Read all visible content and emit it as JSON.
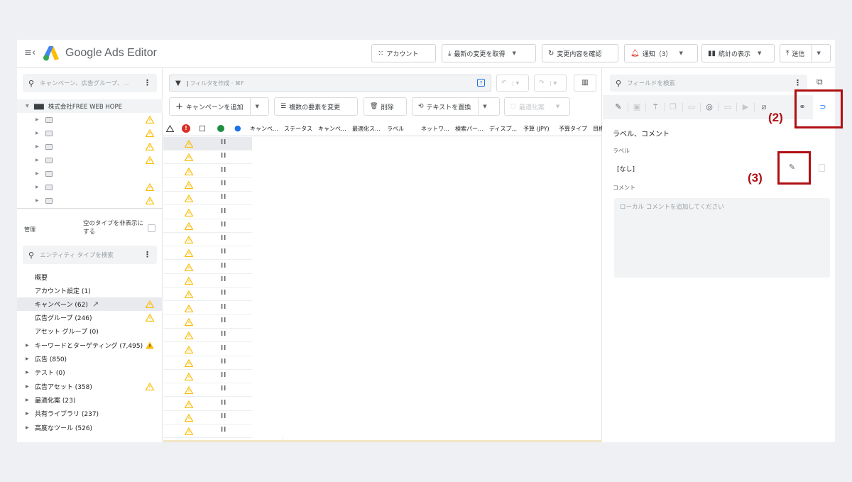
{
  "header": {
    "title": "Google Ads Editor",
    "buttons": {
      "account": "アカウント",
      "get_recent": "最新の変更を取得",
      "review_changes": "変更内容を確認",
      "notifications": "通知（3）",
      "view_stats": "統計の表示",
      "post": "送信"
    }
  },
  "left_panel": {
    "search_placeholder": "キャンペーン、広告グループ、...",
    "account_name": "株式会社FREE WEB HOPE",
    "manage_label": "管理",
    "hide_empty_label": "空のタイプを非表示にする",
    "entity_search_placeholder": "エンティティ タイプを検索",
    "entities": [
      {
        "label": "概要"
      },
      {
        "label": "アカウント設定 (1)"
      },
      {
        "label": "キャンペーン (62)"
      },
      {
        "label": "広告グループ (246)"
      },
      {
        "label": "アセット グループ (0)"
      },
      {
        "label": "キーワードとターゲティング (7,495)"
      },
      {
        "label": "広告 (850)"
      },
      {
        "label": "テスト (0)"
      },
      {
        "label": "広告アセット (358)"
      },
      {
        "label": "最適化案 (23)"
      },
      {
        "label": "共有ライブラリ (237)"
      },
      {
        "label": "高度なツール (526)"
      }
    ]
  },
  "center": {
    "filter_placeholder": "フィルタを作成 · ⌘F",
    "toolbar": {
      "add_campaign": "キャンペーンを追加",
      "multi_change": "複数の要素を変更",
      "delete": "削除",
      "replace_text": "テキストを置換",
      "optimize": "最適化案"
    },
    "columns": [
      "キャンペ...",
      "ステータス",
      "キャンペ...",
      "最適化ス...",
      "ラベル",
      "ネットワ...",
      "検索パー...",
      "ディスプ...",
      "予算 (JPY)",
      "予算タイプ",
      "目標"
    ]
  },
  "right_panel": {
    "search_placeholder": "フィールドを検索",
    "section_title": "ラベル、コメント",
    "label_title": "ラベル",
    "label_value": "[なし]",
    "comment_title": "コメント",
    "comment_placeholder": "ローカル コメントを追加してください"
  },
  "annotations": {
    "step2": "(2)",
    "step3": "(3)"
  },
  "colors": {
    "warning": "#fbbc04",
    "accent": "#1a73e8",
    "annotation": "#b00f12"
  }
}
